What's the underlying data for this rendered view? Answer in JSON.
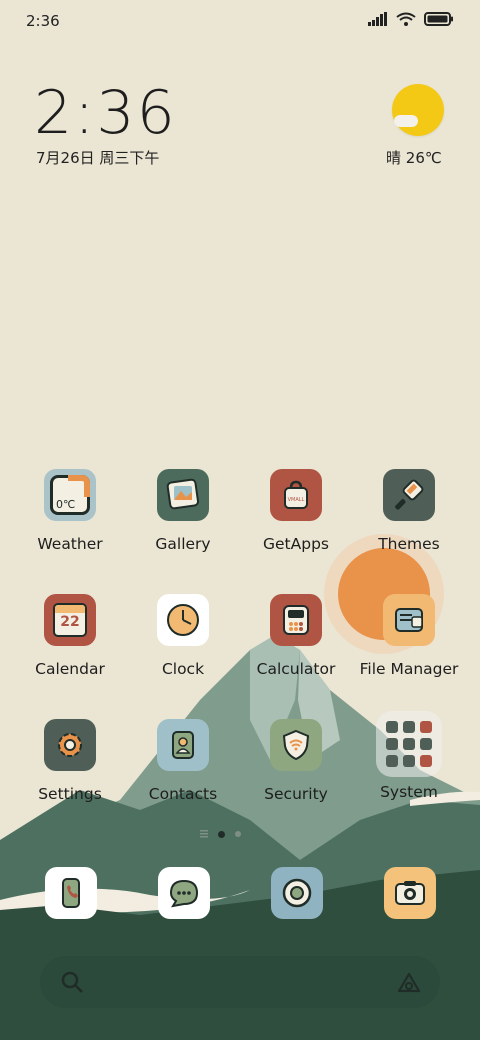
{
  "status_bar": {
    "time": "2:36"
  },
  "clock_widget": {
    "time": "2:36",
    "date": "7月26日 周三下午"
  },
  "weather_widget": {
    "condition": "晴",
    "temperature": "26℃"
  },
  "apps": [
    {
      "label": "Weather",
      "icon": "weather-icon",
      "bg": "#a9c3c9"
    },
    {
      "label": "Gallery",
      "icon": "gallery-icon",
      "bg": "#4c6b5c"
    },
    {
      "label": "GetApps",
      "icon": "shopping-bag-icon",
      "bg": "#b05443"
    },
    {
      "label": "Themes",
      "icon": "paintbrush-icon",
      "bg": "#4f5f57"
    },
    {
      "label": "Calendar",
      "icon": "calendar-icon",
      "bg": "#b05443"
    },
    {
      "label": "Clock",
      "icon": "clock-icon",
      "bg": "#ffffff"
    },
    {
      "label": "Calculator",
      "icon": "calculator-icon",
      "bg": "#b05443"
    },
    {
      "label": "File Manager",
      "icon": "folder-icon",
      "bg": "#f2b973"
    },
    {
      "label": "Settings",
      "icon": "gear-icon",
      "bg": "#4f5f57"
    },
    {
      "label": "Contacts",
      "icon": "contacts-icon",
      "bg": "#9fc0c9"
    },
    {
      "label": "Security",
      "icon": "shield-icon",
      "bg": "#8ea780"
    },
    {
      "label": "System",
      "icon": "folder-grid-icon",
      "bg": "rgba(240,240,240,0.55)"
    }
  ],
  "calendar_day": "22",
  "weather_tile_text": "0℃",
  "getapps_tile_text": "VMALL",
  "dock": [
    {
      "icon": "phone-icon",
      "bg": "#ffffff"
    },
    {
      "icon": "messages-icon",
      "bg": "#ffffff"
    },
    {
      "icon": "browser-icon",
      "bg": "#8fb3c0"
    },
    {
      "icon": "camera-icon",
      "bg": "#f4c27a"
    }
  ],
  "colors": {
    "background": "#ebe5d3",
    "mountain": "#3d5c4a",
    "sun": "#e8924a"
  }
}
